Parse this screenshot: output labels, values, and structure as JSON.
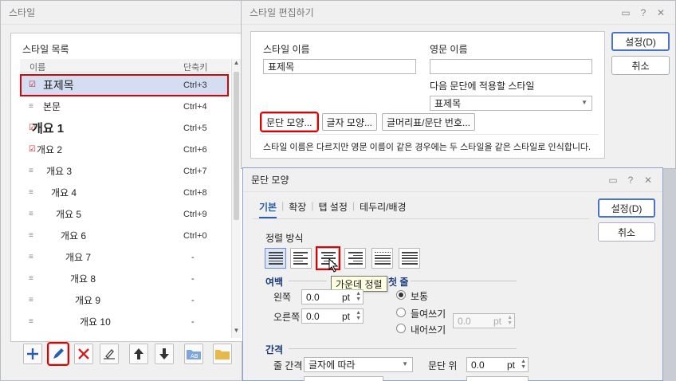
{
  "styles": {
    "title": "스타일",
    "list_title": "스타일 목록",
    "col_name": "이름",
    "col_shortcut": "단축키",
    "items": [
      {
        "name": "표제목",
        "shortcut": "Ctrl+3",
        "selected": true
      },
      {
        "name": "본문",
        "shortcut": "Ctrl+4"
      },
      {
        "name": "개요 1",
        "shortcut": "Ctrl+5"
      },
      {
        "name": "개요 2",
        "shortcut": "Ctrl+6"
      },
      {
        "name": "개요 3",
        "shortcut": "Ctrl+7"
      },
      {
        "name": "개요 4",
        "shortcut": "Ctrl+8"
      },
      {
        "name": "개요 5",
        "shortcut": "Ctrl+9"
      },
      {
        "name": "개요 6",
        "shortcut": "Ctrl+0"
      },
      {
        "name": "개요 7",
        "shortcut": "-"
      },
      {
        "name": "개요 8",
        "shortcut": "-"
      },
      {
        "name": "개요 9",
        "shortcut": "-"
      },
      {
        "name": "개요 10",
        "shortcut": "-"
      }
    ]
  },
  "edit": {
    "title": "스타일 편집하기",
    "name_label": "스타일 이름",
    "name_value": "표제목",
    "eng_label": "영문 이름",
    "eng_value": "",
    "next_label": "다음 문단에 적용할 스타일",
    "next_value": "표제목",
    "btn_para": "문단 모양...",
    "btn_char": "글자 모양...",
    "btn_bullet": "글머리표/문단 번호...",
    "note": "스타일 이름은 다르지만 영문 이름이 같은 경우에는 두 스타일을 같은 스타일로 인식합니다.",
    "ok": "설정(D)",
    "cancel": "취소"
  },
  "para": {
    "title": "문단 모양",
    "tabs": [
      "기본",
      "확장",
      "탭 설정",
      "테두리/배경"
    ],
    "align_label": "정렬 방식",
    "tooltip": "가운데 정렬",
    "margin_label": "여백",
    "left_label": "왼쪽",
    "left_value": "0.0",
    "right_label": "오른쪽",
    "right_value": "0.0",
    "unit": "pt",
    "first_label": "첫 줄",
    "opt_normal": "보통",
    "opt_indent": "들여쓰기",
    "opt_outdent": "내어쓰기",
    "first_value": "0.0",
    "spacing_label": "간격",
    "line_label": "줄 간격",
    "line_value": "글자에 따라",
    "above_label": "문단 위",
    "above_value": "0.0",
    "ok": "설정(D)",
    "cancel": "취소"
  }
}
